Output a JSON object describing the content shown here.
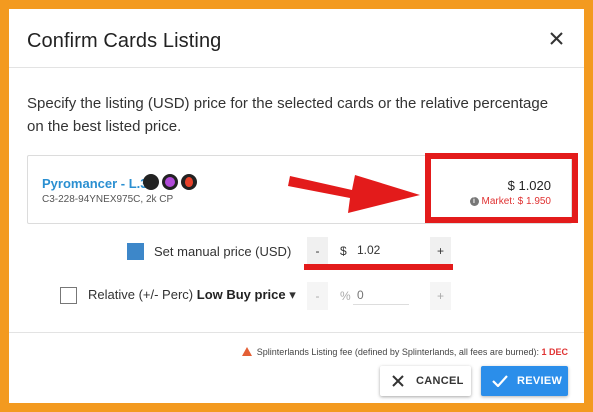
{
  "dialog": {
    "title": "Confirm Cards Listing",
    "description": "Specify the listing (USD) price for the selected cards or the relative percentage on the best listed price."
  },
  "card": {
    "name": "Pyromancer - L.3",
    "id_line": "C3-228-94YNEX975C, 2k CP",
    "icons": [
      "ability-dark-icon",
      "ability-purple-icon",
      "fire-element-icon"
    ],
    "price": "$ 1.020",
    "market_label": "Market: $ 1.950"
  },
  "manual_price": {
    "label": "Set manual price (USD)",
    "minus": "-",
    "prefix": "$",
    "value": "1.02",
    "plus": "+",
    "checked": true
  },
  "relative_price": {
    "label_prefix": "Relative (+/- Perc)",
    "label_bold": "Low Buy price",
    "caret": "▾",
    "minus": "-",
    "prefix": "%",
    "placeholder": "0",
    "plus": "+",
    "checked": false
  },
  "footer": {
    "fee_text": "Splinterlands Listing fee (defined by Splinterlands, all fees are burned):",
    "fee_value": "1 DEC",
    "cancel_label": "CANCEL",
    "review_label": "REVIEW"
  },
  "colors": {
    "frame": "#f39a1f",
    "annotation_red": "#e31b1b",
    "link_blue": "#2a8fd1",
    "primary": "#2b8eea"
  }
}
